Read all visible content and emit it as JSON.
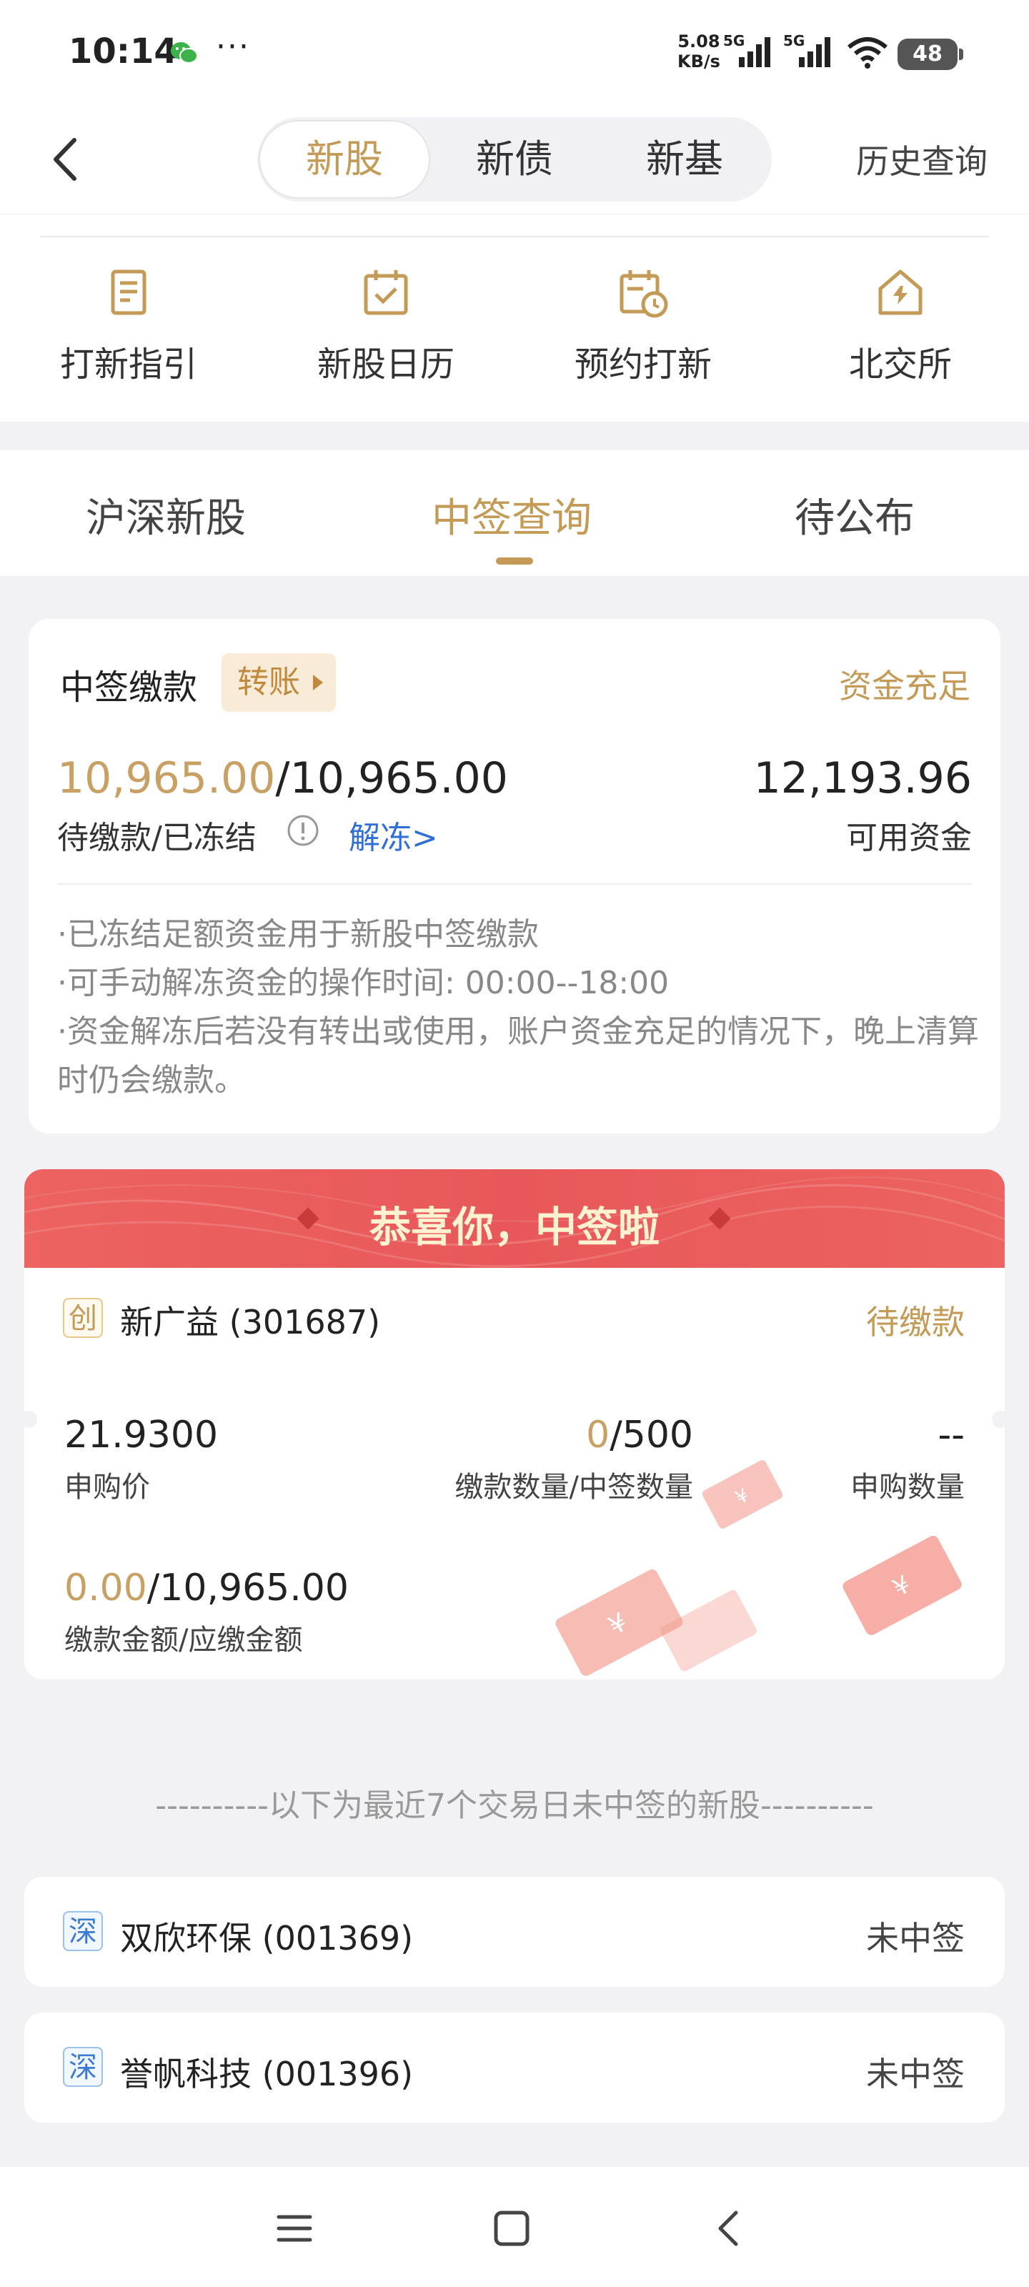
{
  "status_bar": {
    "time": "10:14",
    "dots": "···",
    "net_speed_value": "5.08",
    "net_speed_unit": "KB/s",
    "sim1_label": "5G",
    "sim2_label": "5G",
    "battery": "48",
    "icons": [
      "wechat-icon",
      "signal-icon",
      "wifi-icon",
      "battery-icon"
    ]
  },
  "header": {
    "back_icon": "chevron-left-icon",
    "segments": [
      "新股",
      "新债",
      "新基"
    ],
    "active_segment": "新股",
    "history_link": "历史查询"
  },
  "quick_entries": [
    {
      "label": "打新指引",
      "icon": "guide-doc-icon"
    },
    {
      "label": "新股日历",
      "icon": "calendar-check-icon"
    },
    {
      "label": "预约打新",
      "icon": "calendar-clock-icon"
    },
    {
      "label": "北交所",
      "icon": "exchange-house-icon"
    }
  ],
  "sub_tabs": [
    "沪深新股",
    "中签查询",
    "待公布"
  ],
  "active_sub_tab": "中签查询",
  "payment": {
    "title": "中签缴款",
    "transfer_label": "转账",
    "fund_status": "资金充足",
    "pending_amount": "10,965.00",
    "frozen_amount": "/10,965.00",
    "pending_label": "待缴款/已冻结",
    "unfreeze_label": "解冻>",
    "available_value": "12,193.96",
    "available_label": "可用资金",
    "notes": [
      "·已冻结足额资金用于新股中签缴款",
      "·可手动解冻资金的操作时间: 00:00--18:00",
      "·资金解冻后若没有转出或使用，账户资金充足的情况下，晚上清算时仍会缴款。"
    ]
  },
  "win": {
    "banner_text": "恭喜你，中签啦",
    "badge": "创",
    "stock": "新广益 (301687)",
    "status": "待缴款",
    "price_value": "21.9300",
    "price_label": "申购价",
    "paid_qty": "0",
    "won_qty": "/500",
    "qty_label": "缴款数量/中签数量",
    "sub_qty_value": "--",
    "sub_qty_label": "申购数量",
    "paid_amount": "0.00",
    "due_amount": "/10,965.00",
    "amount_label": "缴款金额/应缴金额"
  },
  "separator_text": "----------以下为最近7个交易日未中签的新股----------",
  "unsuccessful": [
    {
      "badge": "深",
      "name": "双欣环保 (001369)",
      "status": "未中签"
    },
    {
      "badge": "深",
      "name": "誉帆科技 (001396)",
      "status": "未中签"
    }
  ],
  "nav_bar": [
    "menu-icon",
    "home-square-icon",
    "back-triangle-icon"
  ],
  "colors": {
    "accent_gold": "#c49a57",
    "banner_red": "#e8585a",
    "link_blue": "#2f6fd6",
    "background": "#f2f2f4"
  }
}
